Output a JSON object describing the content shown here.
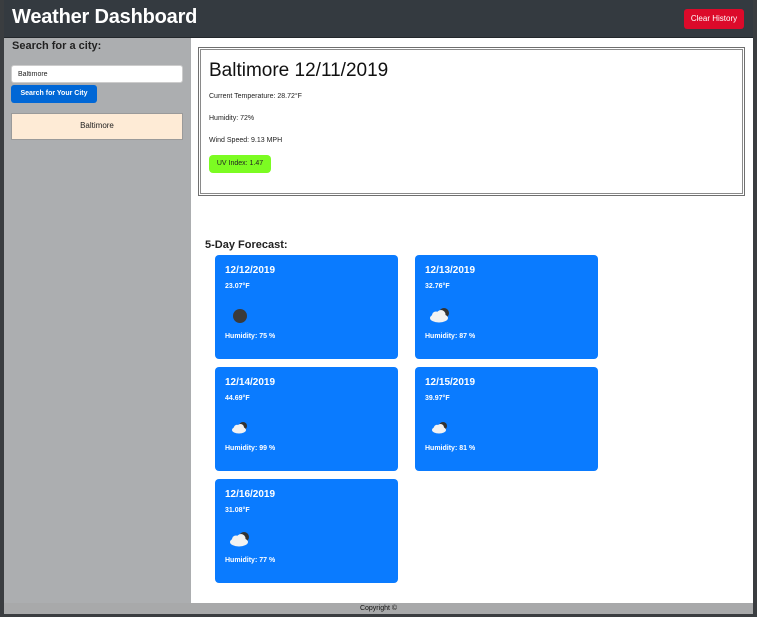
{
  "header": {
    "title": "Weather Dashboard",
    "clear_label": "Clear History"
  },
  "sidebar": {
    "search_label": "Search for a city:",
    "search_value": "Baltimore",
    "search_button_label": "Search for Your City",
    "history": [
      "Baltimore"
    ]
  },
  "current": {
    "title": "Baltimore 12/11/2019",
    "temperature": "Current Temperature: 28.72°F",
    "humidity": "Humidity: 72%",
    "wind": "Wind Speed: 9.13 MPH",
    "uv": "UV Index: 1.47",
    "uv_color": "#7cfc22"
  },
  "forecast": {
    "heading": "5-Day Forecast:",
    "card_color": "#0a7bff",
    "days": [
      {
        "date": "12/12/2019",
        "temp": "23.07°F",
        "icon": "clear-night-icon",
        "humidity": "Humidity: 75 %"
      },
      {
        "date": "12/13/2019",
        "temp": "32.76°F",
        "icon": "partly-cloudy-night-icon",
        "humidity": "Humidity: 87 %"
      },
      {
        "date": "12/14/2019",
        "temp": "44.69°F",
        "icon": "partly-cloudy-night-icon",
        "humidity": "Humidity: 99 %"
      },
      {
        "date": "12/15/2019",
        "temp": "39.97°F",
        "icon": "partly-cloudy-night-icon",
        "humidity": "Humidity: 81 %"
      },
      {
        "date": "12/16/2019",
        "temp": "31.08°F",
        "icon": "partly-cloudy-night-icon",
        "humidity": "Humidity: 77 %"
      }
    ]
  },
  "footer": {
    "text": "Copyright ©"
  }
}
